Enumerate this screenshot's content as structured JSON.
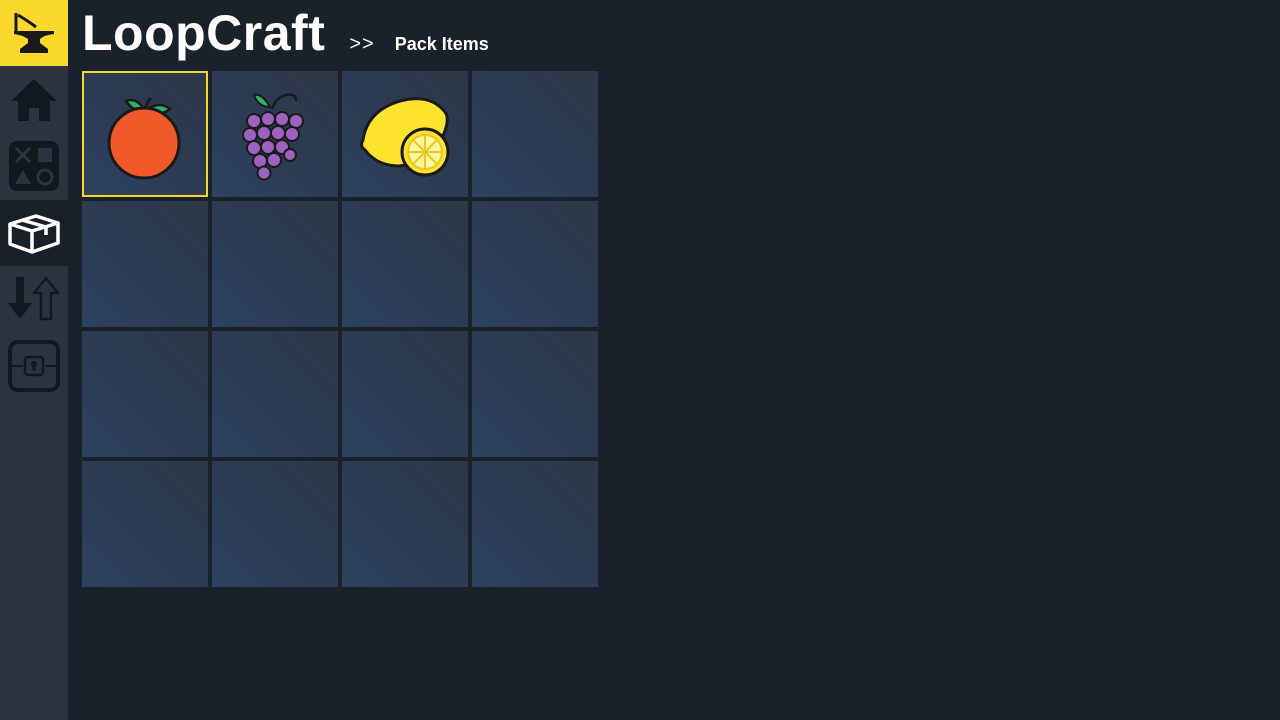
{
  "app": {
    "title": "LoopCraft",
    "breadcrumb_separator": ">>",
    "breadcrumb_current": "Pack Items"
  },
  "sidebar": {
    "items": [
      {
        "icon": "home-icon",
        "active": false
      },
      {
        "icon": "games-icon",
        "active": false
      },
      {
        "icon": "package-icon",
        "active": true
      },
      {
        "icon": "sort-icon",
        "active": false
      },
      {
        "icon": "vault-icon",
        "active": false
      }
    ]
  },
  "inventory": {
    "columns": 4,
    "rows": 4,
    "selected_slot": 0,
    "slots": [
      {
        "item": "orange-icon"
      },
      {
        "item": "grapes-icon"
      },
      {
        "item": "lemon-icon"
      },
      {
        "item": null
      },
      {
        "item": null
      },
      {
        "item": null
      },
      {
        "item": null
      },
      {
        "item": null
      },
      {
        "item": null
      },
      {
        "item": null
      },
      {
        "item": null
      },
      {
        "item": null
      },
      {
        "item": null
      },
      {
        "item": null
      },
      {
        "item": null
      },
      {
        "item": null
      }
    ]
  },
  "colors": {
    "accent": "#fbd82c",
    "selection_border": "#f2d92a",
    "background": "#19212b",
    "sidebar": "#2b3340"
  }
}
